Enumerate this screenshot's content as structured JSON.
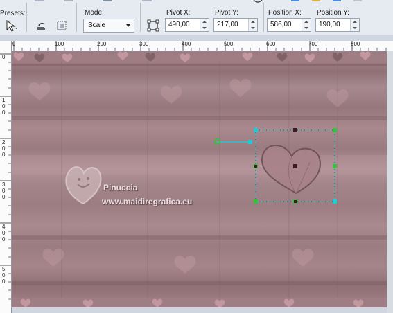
{
  "toolbar": {
    "presets_label": "Presets:",
    "mode_label": "Mode:",
    "mode_value": "Scale",
    "pivot_x_label": "Pivot X:",
    "pivot_x_value": "490,00",
    "pivot_y_label": "Pivot Y:",
    "pivot_y_value": "217,00",
    "position_x_label": "Position X:",
    "position_x_value": "586,00",
    "position_y_label": "Position Y:",
    "position_y_value": "190,00"
  },
  "rulers": {
    "h_ticks": [
      "0",
      "100",
      "200",
      "300",
      "400",
      "500",
      "600",
      "700",
      "800"
    ],
    "v_ticks": [
      "0",
      "1 0 0",
      "2 0 0",
      "3 0 0",
      "4 0 0",
      "5 0 0"
    ]
  },
  "watermark": {
    "name": "Pinuccia",
    "site": "www.maidiregrafica.eu"
  },
  "colors": {
    "selection": "#1fc9d6",
    "handle_green": "#3bbf3b",
    "handle_dark": "#3a1a1e"
  }
}
